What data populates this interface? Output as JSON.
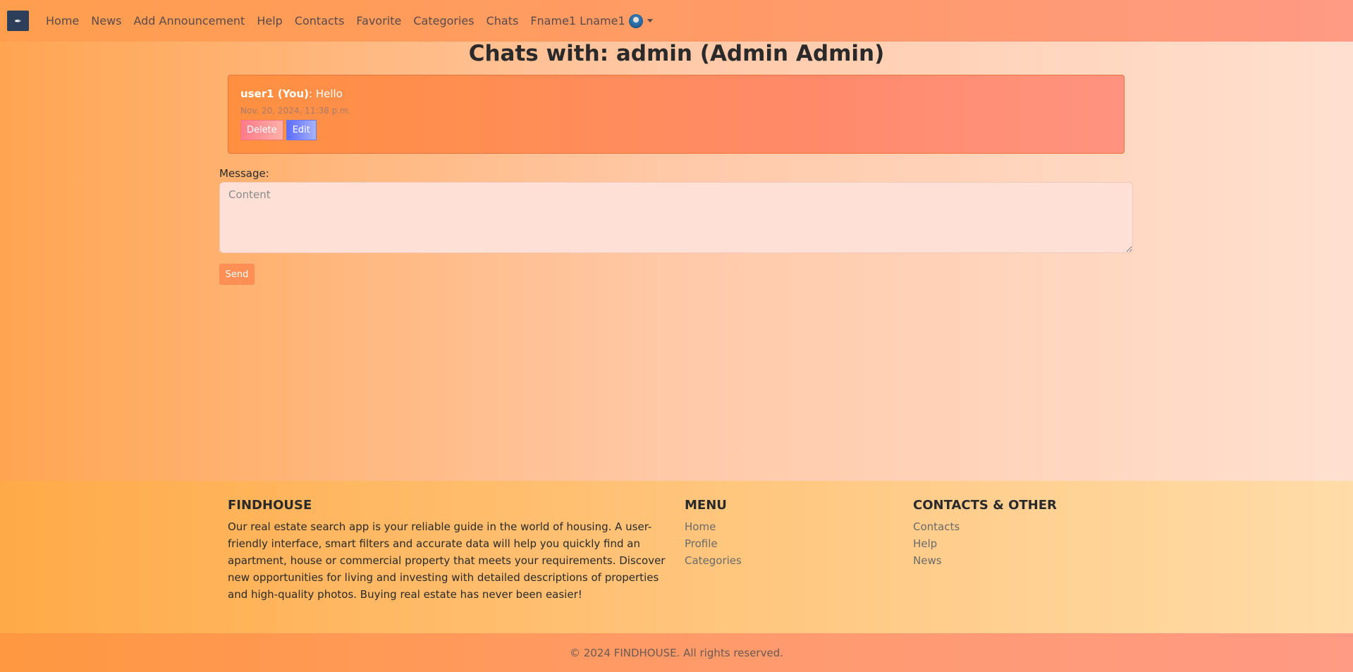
{
  "nav": {
    "brand_icon": "feather-logo-icon",
    "items": [
      {
        "label": "Home"
      },
      {
        "label": "News"
      },
      {
        "label": "Add Announcement"
      },
      {
        "label": "Help"
      },
      {
        "label": "Contacts"
      },
      {
        "label": "Favorite"
      },
      {
        "label": "Categories"
      },
      {
        "label": "Chats"
      }
    ],
    "user_name": "Fname1 Lname1"
  },
  "page": {
    "title": "Chats with: admin (Admin Admin)"
  },
  "messages": [
    {
      "author": "user1 (You)",
      "text": ": Hello",
      "timestamp": "Nov. 20, 2024, 11:38 p.m.",
      "delete_label": "Delete",
      "edit_label": "Edit"
    }
  ],
  "compose": {
    "label": "Message:",
    "placeholder": "Content",
    "value": "",
    "send_label": "Send"
  },
  "footer": {
    "about": {
      "heading": "FINDHOUSE",
      "text": "Our real estate search app is your reliable guide in the world of housing. A user-friendly interface, smart filters and accurate data will help you quickly find an apartment, house or commercial property that meets your requirements. Discover new opportunities for living and investing with detailed descriptions of properties and high-quality photos. Buying real estate has never been easier!"
    },
    "menu": {
      "heading": "MENU",
      "links": [
        "Home",
        "Profile",
        "Categories"
      ]
    },
    "contacts": {
      "heading": "CONTACTS & OTHER",
      "links": [
        "Contacts",
        "Help",
        "News"
      ]
    },
    "copyright": "© 2024 FINDHOUSE. All rights reserved."
  },
  "colors": {
    "accent": "#ff8f55",
    "delete": "#ff7a8a",
    "edit": "#5b6cff"
  }
}
